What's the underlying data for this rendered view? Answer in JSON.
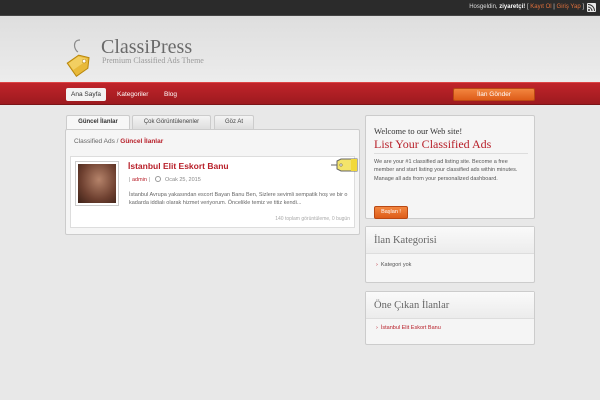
{
  "topbar": {
    "greeting": "Hosgeldin,",
    "user": "ziyaretçi!",
    "sep1": "[",
    "register": "Kayıt Ol",
    "sep2": "|",
    "login": "Giriş Yap",
    "sep3": "]",
    "rss_icon": "rss-icon"
  },
  "header": {
    "title": "ClassiPress",
    "subtitle": "Premium Classified Ads Theme",
    "logo_icon": "price-tag-icon"
  },
  "nav": {
    "items": [
      "Ana Sayfa",
      "Kategoriler",
      "Blog"
    ],
    "active": "Ana Sayfa",
    "post_ad": "İlan Gönder"
  },
  "tabs": [
    "Güncel İlanlar",
    "Çok Görüntülenenler",
    "Göz At"
  ],
  "breadcrumb": {
    "root": "Classified Ads",
    "sep": "/",
    "current": "Güncel İlanlar"
  },
  "listing": {
    "title": "İstanbul Elit Eskort Banu",
    "author": "admin",
    "date": "Ocak 25, 2015",
    "description": "İstanbul Avrupa yakasından escort Bayan Banu Ben, Sizlere sevimli sempatik hoş ve bir o kadarda iddialı olarak hizmet veriyorum. Öncelikle temiz ve titiz kendi...",
    "stats": "140 toplam görüntüleme, 0 bugün"
  },
  "welcome_widget": {
    "heading": "Welcome to our Web site!",
    "subheading": "List Your Classified Ads",
    "text": "We are your #1 classified ad listing site. Become a free member and start listing your classified ads within minutes. Manage all ads from your personalized dashboard.",
    "button": "Başlan !"
  },
  "category_widget": {
    "title": "İlan Kategorisi",
    "empty": "Kategori yok"
  },
  "featured_widget": {
    "title": "Öne Çıkan İlanlar",
    "items": [
      "İstanbul Elit Eskort Banu"
    ]
  },
  "colors": {
    "accent": "#b8202a",
    "nav_bg": "#b01f25",
    "button_orange": "#e8702c"
  }
}
